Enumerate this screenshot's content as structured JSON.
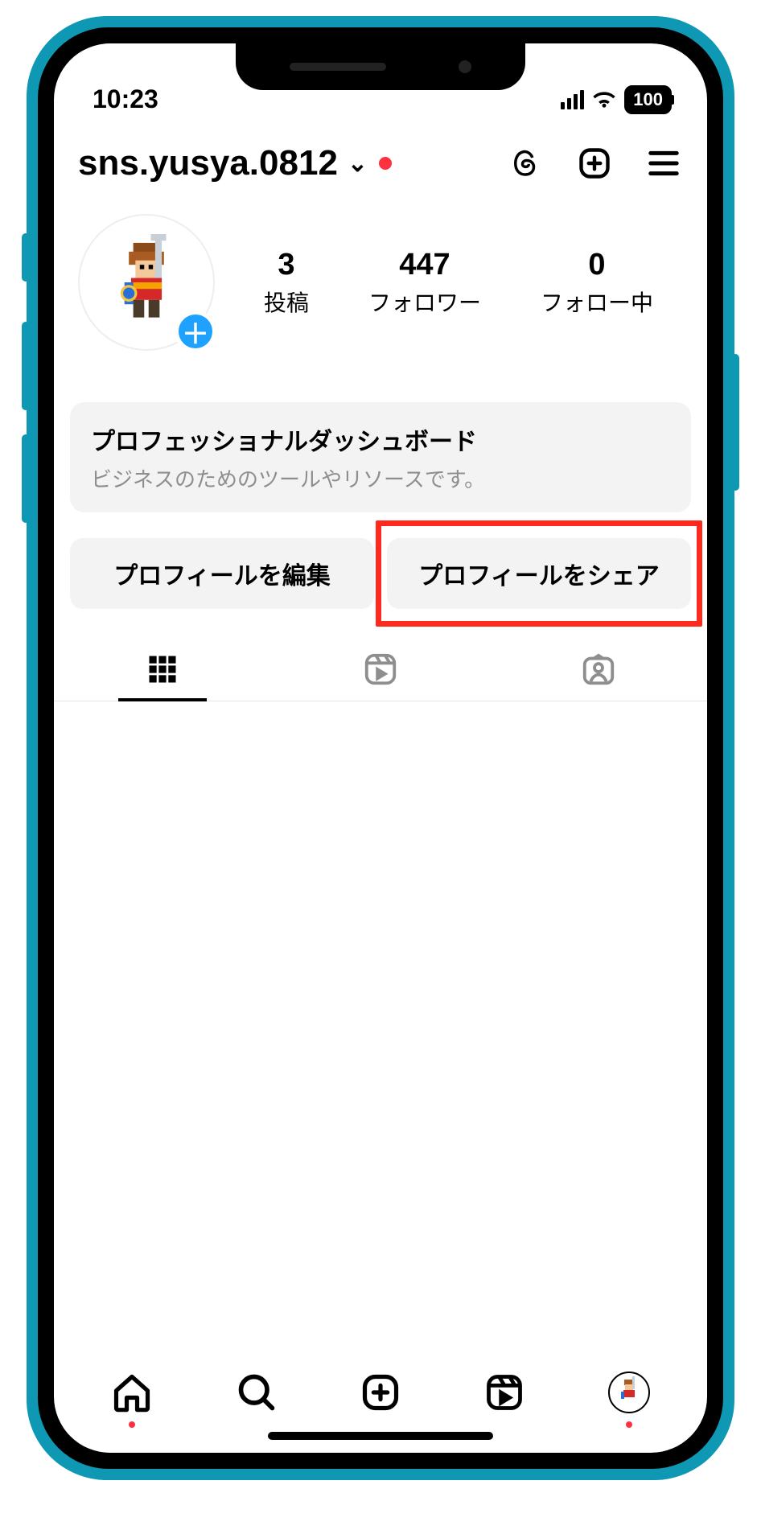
{
  "status": {
    "time": "10:23",
    "battery": "100"
  },
  "header": {
    "username": "sns.yusya.0812",
    "has_notification_dot": true
  },
  "profile": {
    "stats": [
      {
        "value": "3",
        "label": "投稿"
      },
      {
        "value": "447",
        "label": "フォロワー"
      },
      {
        "value": "0",
        "label": "フォロー中"
      }
    ]
  },
  "dashboard": {
    "title": "プロフェッショナルダッシュボード",
    "subtitle": "ビジネスのためのツールやリソースです。"
  },
  "actions": {
    "edit": "プロフィールを編集",
    "share": "プロフィールをシェア"
  },
  "annotation": {
    "highlighted_button": "share"
  }
}
